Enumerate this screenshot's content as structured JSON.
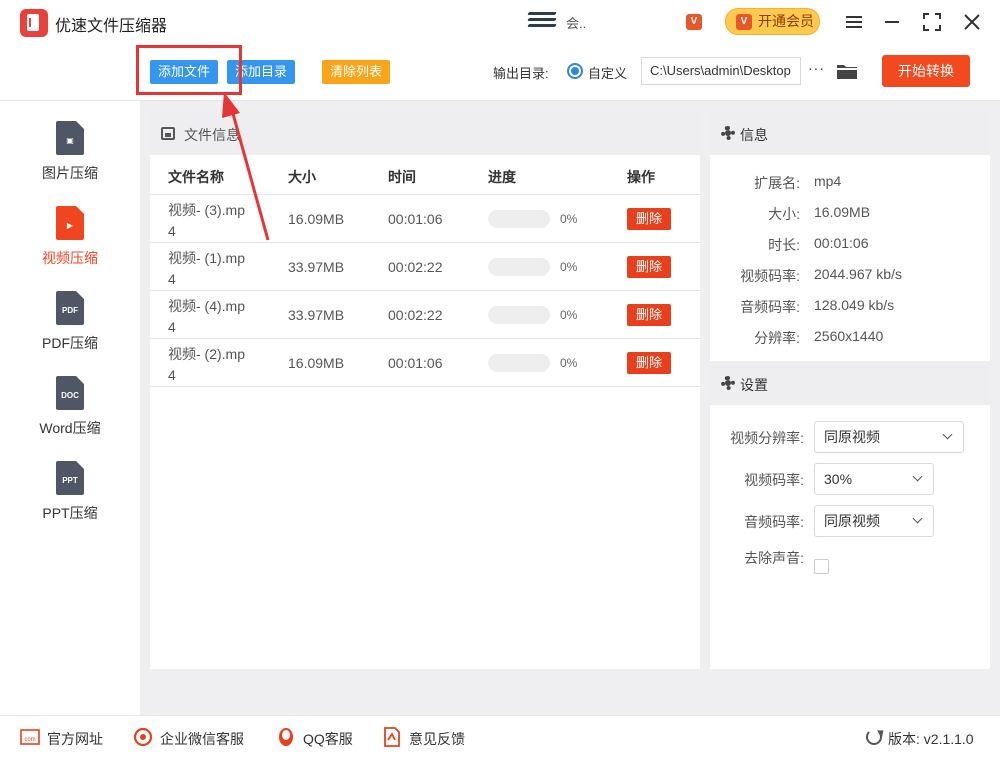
{
  "window": {
    "app_title": "优速文件压缩器",
    "user_name": "会..",
    "vip_small_icon": "V",
    "vip_button_label": "开通会员",
    "vip_icon_text": "V"
  },
  "toolbar": {
    "add_file_label": "添加文件",
    "add_dir_label": "添加目录",
    "clear_list_label": "清除列表",
    "output_dir_label": "输出目录:",
    "custom_option_label": "自定义",
    "output_path_value": "C:\\Users\\admin\\Desktop",
    "more_label": "···",
    "start_label": "开始转换"
  },
  "sidebar": {
    "items": [
      {
        "label": "图片压缩",
        "icon": "image-file-icon",
        "glyph": "▣",
        "active": false
      },
      {
        "label": "视频压缩",
        "icon": "video-file-icon",
        "glyph": "▶",
        "active": true
      },
      {
        "label": "PDF压缩",
        "icon": "pdf-file-icon",
        "glyph": "PDF",
        "active": false
      },
      {
        "label": "Word压缩",
        "icon": "doc-file-icon",
        "glyph": "DOC",
        "active": false
      },
      {
        "label": "PPT压缩",
        "icon": "ppt-file-icon",
        "glyph": "PPT",
        "active": false
      }
    ]
  },
  "file_panel": {
    "title": "文件信息",
    "columns": {
      "name": "文件名称",
      "size": "大小",
      "time": "时间",
      "progress": "进度",
      "action": "操作"
    },
    "rows": [
      {
        "name": "视频- (3).mp4",
        "size": "16.09MB",
        "time": "00:01:06",
        "progress": 0,
        "progress_label": "0%",
        "action": "删除"
      },
      {
        "name": "视频- (1).mp4",
        "size": "33.97MB",
        "time": "00:02:22",
        "progress": 0,
        "progress_label": "0%",
        "action": "删除"
      },
      {
        "name": "视频- (4).mp4",
        "size": "33.97MB",
        "time": "00:02:22",
        "progress": 0,
        "progress_label": "0%",
        "action": "删除"
      },
      {
        "name": "视频- (2).mp4",
        "size": "16.09MB",
        "time": "00:01:06",
        "progress": 0,
        "progress_label": "0%",
        "action": "删除"
      }
    ]
  },
  "info": {
    "title": "信息",
    "fields": [
      {
        "label": "扩展名:",
        "value": "mp4"
      },
      {
        "label": "大小:",
        "value": "16.09MB"
      },
      {
        "label": "时长:",
        "value": "00:01:06"
      },
      {
        "label": "视频码率:",
        "value": "2044.967 kb/s"
      },
      {
        "label": "音频码率:",
        "value": "128.049 kb/s"
      },
      {
        "label": "分辨率:",
        "value": "2560x1440"
      }
    ]
  },
  "settings": {
    "title": "设置",
    "video_resolution_label": "视频分辨率:",
    "video_resolution_value": "同原视频",
    "video_bitrate_label": "视频码率:",
    "video_bitrate_value": "30%",
    "audio_bitrate_label": "音频码率:",
    "audio_bitrate_value": "同原视频",
    "remove_audio_label": "去除声音:",
    "remove_audio_checked": false
  },
  "footer": {
    "website_label": "官方网址",
    "wechat_label": "企业微信客服",
    "qq_label": "QQ客服",
    "feedback_label": "意见反馈",
    "version_text": "版本:  v2.1.1.0"
  },
  "colors": {
    "accent_blue": "#3596f0",
    "accent_red": "#f24a1e",
    "accent_orange": "#f8a51b",
    "annotation_red": "#e63535"
  }
}
